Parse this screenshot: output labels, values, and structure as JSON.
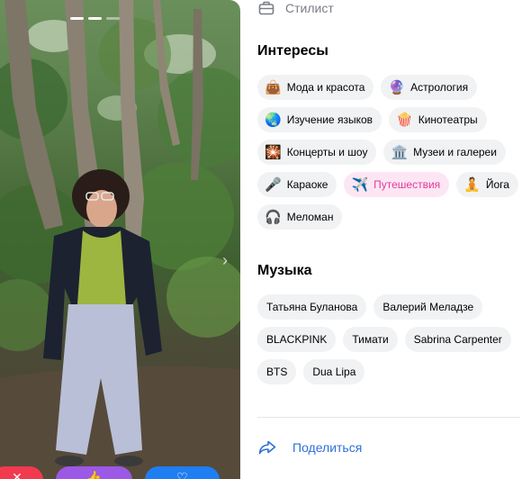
{
  "profile": {
    "job": {
      "icon": "briefcase-icon",
      "text": "Стилист"
    }
  },
  "gallery": {
    "photo_count": 3,
    "active_photo": 2,
    "next_icon": "chevron-right-icon"
  },
  "actions": {
    "dislike": {
      "icon": "close-icon",
      "color": "#f23a4e"
    },
    "superlike": {
      "icon": "thumbs-up-icon",
      "color": "#9b59e6"
    },
    "like": {
      "icon": "heart-icon",
      "color": "#1f7ef2"
    }
  },
  "interests": {
    "title": "Интересы",
    "items": [
      {
        "emoji": "👜",
        "label": "Мода и красота",
        "active": false
      },
      {
        "emoji": "🔮",
        "label": "Астрология",
        "active": false
      },
      {
        "emoji": "🌏",
        "label": "Изучение языков",
        "active": false
      },
      {
        "emoji": "🍿",
        "label": "Кинотеатры",
        "active": false
      },
      {
        "emoji": "🎇",
        "label": "Концерты и шоу",
        "active": false
      },
      {
        "emoji": "🏛️",
        "label": "Музеи и галереи",
        "active": false
      },
      {
        "emoji": "🎤",
        "label": "Караоке",
        "active": false
      },
      {
        "emoji": "✈️",
        "label": "Путешествия",
        "active": true
      },
      {
        "emoji": "🧘",
        "label": "Йога",
        "active": false
      },
      {
        "emoji": "🎧",
        "label": "Меломан",
        "active": false
      }
    ]
  },
  "music": {
    "title": "Музыка",
    "items": [
      "Татьяна Буланова",
      "Валерий Меладзе",
      "BLACKPINK",
      "Тимати",
      "Sabrina Carpenter",
      "BTS",
      "Dua Lipa"
    ]
  },
  "share": {
    "icon": "share-arrow-icon",
    "label": "Поделиться"
  },
  "colors": {
    "accent": "#2f6fd8",
    "active_chip_bg": "#fde6f4",
    "active_chip_text": "#e23b9a",
    "chip_bg": "#f1f2f4"
  }
}
